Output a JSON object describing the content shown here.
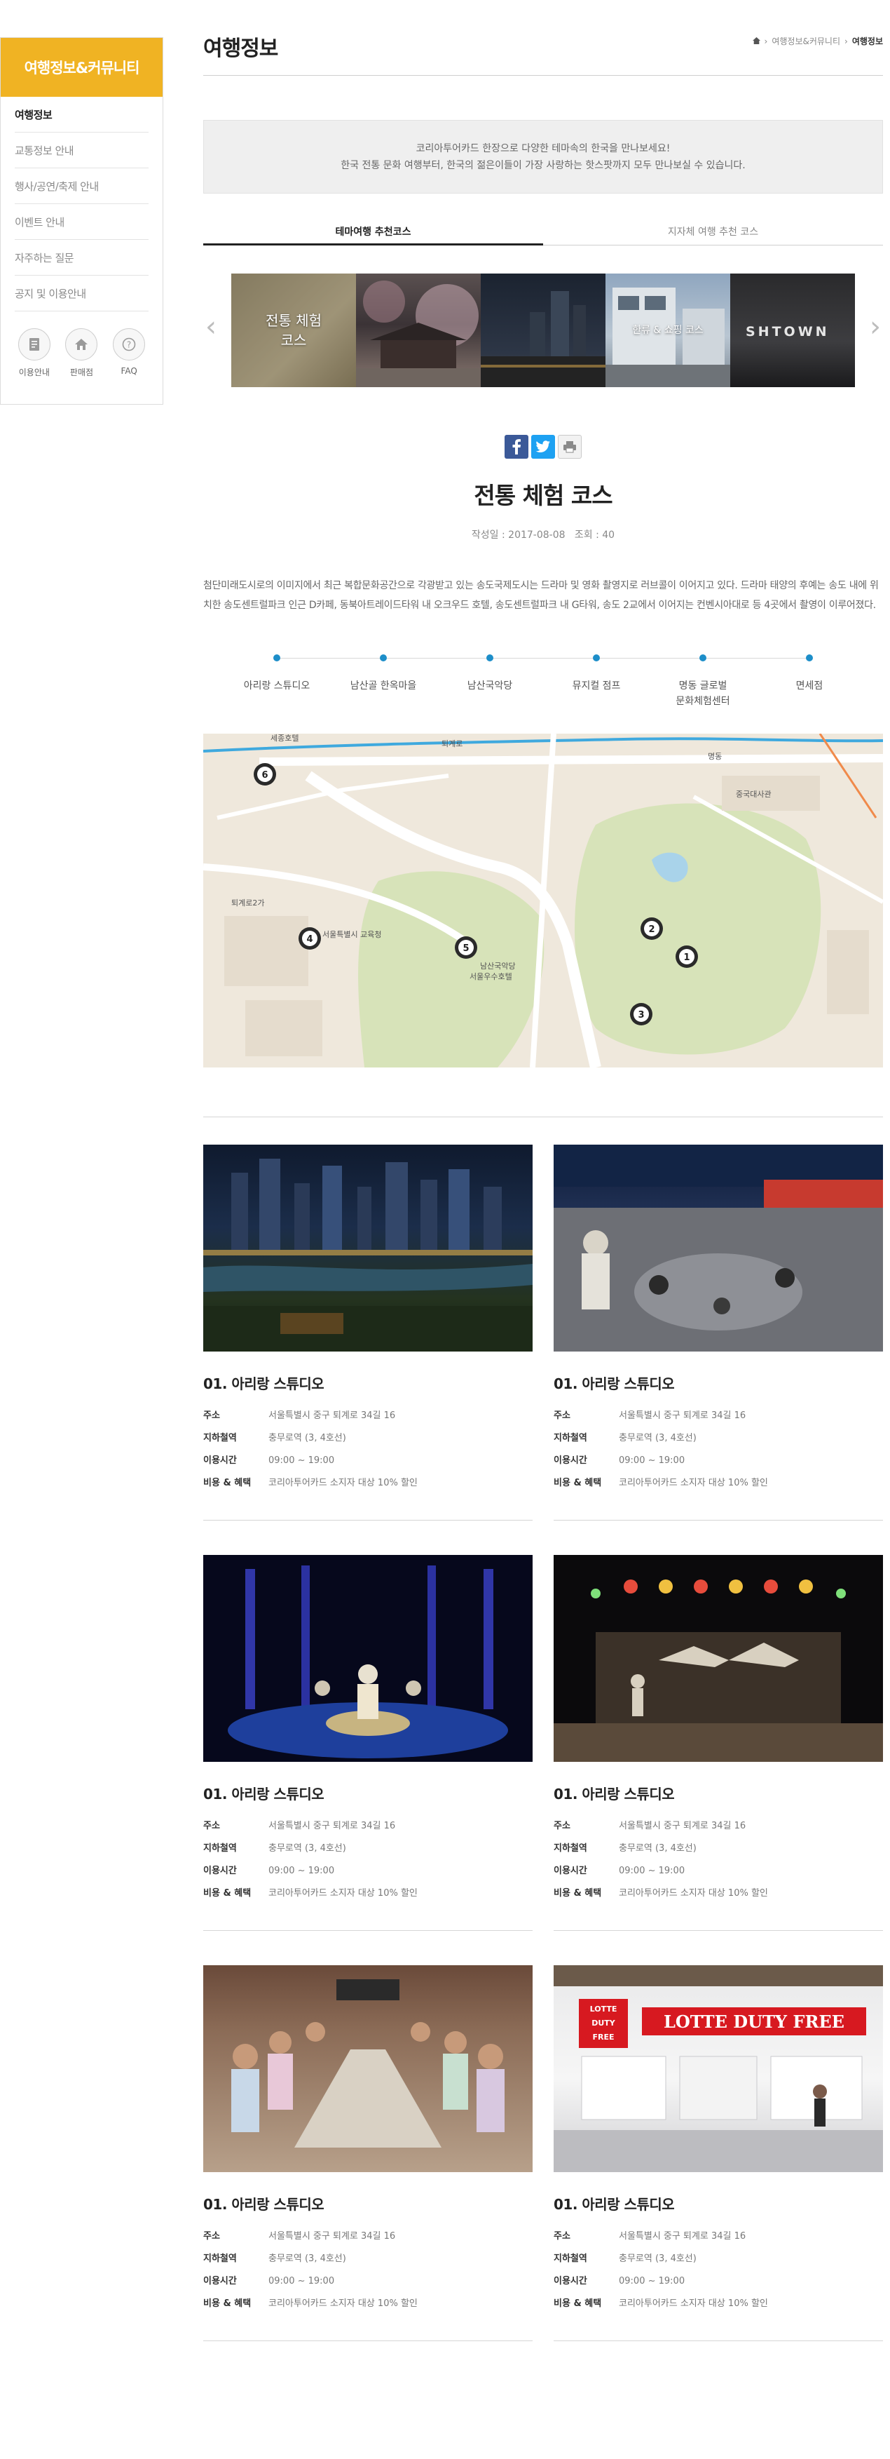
{
  "sidebar": {
    "title": "여행정보&커뮤니티",
    "items": [
      {
        "label": "여행정보",
        "active": true
      },
      {
        "label": "교통정보 안내",
        "active": false
      },
      {
        "label": "행사/공연/축제 안내",
        "active": false
      },
      {
        "label": "이벤트 안내",
        "active": false
      },
      {
        "label": "자주하는 질문",
        "active": false
      },
      {
        "label": "공지 및 이용안내",
        "active": false
      }
    ],
    "quick": [
      {
        "label": "이용안내",
        "icon": "document-icon"
      },
      {
        "label": "판매점",
        "icon": "home-icon"
      },
      {
        "label": "FAQ",
        "icon": "question-icon"
      }
    ]
  },
  "header": {
    "title": "여행정보",
    "breadcrumb": [
      "여행정보&커뮤니티",
      "여행정보"
    ]
  },
  "notice": {
    "line1": "코리아투어카드 한장으로 다양한 테마속의 한국을 만나보세요!",
    "line2": "한국 전통 문화 여행부터, 한국의 젊은이들이 가장 사랑하는 핫스팟까지 모두 만나보실 수 있습니다."
  },
  "tabs": [
    {
      "label": "테마여행 추천코스",
      "active": true
    },
    {
      "label": "지자체 여행 추천 코스",
      "active": false
    }
  ],
  "carousel": {
    "prev": "‹",
    "next": "›",
    "slides": [
      {
        "label": "전통 체험\n코스"
      },
      {
        "label": ""
      },
      {
        "label": ""
      },
      {
        "label": "한류 & 쇼핑 코스"
      },
      {
        "label": ""
      }
    ]
  },
  "article": {
    "title": "전통 체험 코스",
    "meta": "작성일 : 2017-08-08   조회 : 40",
    "description": "첨단미래도시로의 이미지에서 최근 복합문화공간으로 각광받고 있는 송도국제도시는 드라마 및 영화 촬영지로 러브콜이 이어지고 있다. 드라마 태양의 후예는 송도 내에 위치한 송도센트럴파크 인근 D카페, 동북아트레이드타워 내 오크우드 호텔, 송도센트럴파크 내 G타워, 송도 2교에서 이어지는 컨벤시아대로 등 4곳에서 촬영이 이루어졌다."
  },
  "timeline": [
    "아리랑 스튜디오",
    "남산골 한옥마을",
    "남산국악당",
    "뮤지컬 점프",
    "명동 글로벌\n문화체험센터",
    "면세점"
  ],
  "map": {
    "markers": [
      "1",
      "2",
      "3",
      "4",
      "5",
      "6"
    ],
    "labels": [
      "세종호텔",
      "퇴계로",
      "명동",
      "서울특별시 교육청",
      "남산국악당",
      "서울우수호텔",
      "중국대사관",
      "퇴계로2가"
    ]
  },
  "spots": [
    {
      "name": "01. 아리랑 스튜디오",
      "address": "서울특별시 중구 퇴계로 34길 16",
      "subway": "충무로역 (3, 4호선)",
      "hours": "09:00 ~ 19:00",
      "benefit": "코리아투어카드 소지자 대상 10% 할인"
    },
    {
      "name": "01. 아리랑 스튜디오",
      "address": "서울특별시 중구 퇴계로 34길 16",
      "subway": "충무로역 (3, 4호선)",
      "hours": "09:00 ~ 19:00",
      "benefit": "코리아투어카드 소지자 대상 10% 할인"
    },
    {
      "name": "01. 아리랑 스튜디오",
      "address": "서울특별시 중구 퇴계로 34길 16",
      "subway": "충무로역 (3, 4호선)",
      "hours": "09:00 ~ 19:00",
      "benefit": "코리아투어카드 소지자 대상 10% 할인"
    },
    {
      "name": "01. 아리랑 스튜디오",
      "address": "서울특별시 중구 퇴계로 34길 16",
      "subway": "충무로역 (3, 4호선)",
      "hours": "09:00 ~ 19:00",
      "benefit": "코리아투어카드 소지자 대상 10% 할인"
    },
    {
      "name": "01. 아리랑 스튜디오",
      "address": "서울특별시 중구 퇴계로 34길 16",
      "subway": "충무로역 (3, 4호선)",
      "hours": "09:00 ~ 19:00",
      "benefit": "코리아투어카드 소지자 대상 10% 할인"
    },
    {
      "name": "01. 아리랑 스튜디오",
      "address": "서울특별시 중구 퇴계로 34길 16",
      "subway": "충무로역 (3, 4호선)",
      "hours": "09:00 ~ 19:00",
      "benefit": "코리아투어카드 소지자 대상 10% 할인"
    }
  ],
  "info_labels": {
    "address": "주소",
    "subway": "지하철역",
    "hours": "이용시간",
    "benefit": "비용 & 혜택"
  },
  "photo_signs": {
    "lotte": "LOTTE DUTY FREE",
    "lotte_box": "LOTTE\nDUTY\nFREE",
    "showtown": "SHTOWN"
  },
  "colors": {
    "accent": "#f0b323",
    "timeline_dot": "#1d8ec9",
    "facebook": "#3b5998",
    "twitter": "#1da1f2",
    "print": "#9a9a9a"
  }
}
